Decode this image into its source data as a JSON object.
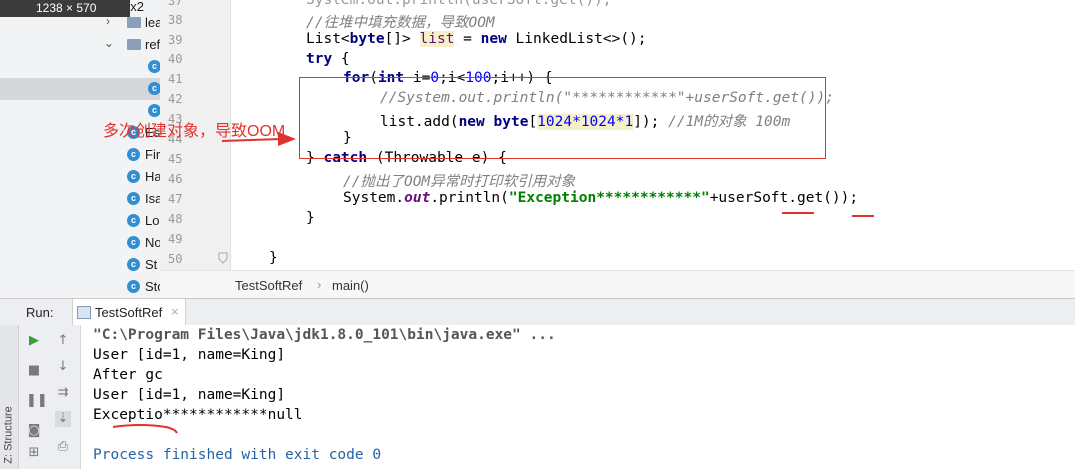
{
  "overlay": {
    "dimensions": "1238 × 570"
  },
  "tree": {
    "items": [
      {
        "label": "ex2",
        "kind": "folder"
      },
      {
        "label": "lea",
        "kind": "folder"
      },
      {
        "label": "ref",
        "kind": "folder"
      },
      {
        "label": "",
        "kind": "class"
      },
      {
        "label": "",
        "kind": "class"
      },
      {
        "label": "",
        "kind": "class"
      },
      {
        "label": "Es",
        "kind": "class"
      },
      {
        "label": "Fir",
        "kind": "class"
      },
      {
        "label": "Ha",
        "kind": "class"
      },
      {
        "label": "Isa",
        "kind": "class"
      },
      {
        "label": "Lo",
        "kind": "class"
      },
      {
        "label": "No",
        "kind": "class"
      },
      {
        "label": "St",
        "kind": "class"
      },
      {
        "label": "Sto",
        "kind": "class"
      }
    ]
  },
  "editor": {
    "line_numbers": [
      "37",
      "38",
      "39",
      "40",
      "41",
      "42",
      "43",
      "44",
      "45",
      "46",
      "47",
      "48",
      "49",
      "50"
    ],
    "line37": "System.out.println(userSoft.get());",
    "line38_comment": "//往堆中填充数据，导致OOM",
    "line39_a": "List<",
    "line39_kw": "byte",
    "line39_b": "[]> ",
    "line39_var": "list",
    "line39_c": " = ",
    "line39_new": "new",
    "line39_d": " LinkedList<>();",
    "line40_kw": "try",
    "line40_b": " {",
    "line41_kw": "for",
    "line41_a": "(",
    "line41_int": "int",
    "line41_b": " i=",
    "line41_n0": "0",
    "line41_c": ";i<",
    "line41_n100": "100",
    "line41_d": ";i++) {",
    "line42_comment": "//System.out.println(\"************\"+userSoft.get());",
    "line43_a": "list.add(",
    "line43_new": "new",
    "line43_sp": " ",
    "line43_byte": "byte",
    "line43_b": "[",
    "line43_expr": "1024*1024*1",
    "line43_c": "]); ",
    "line43_comment": "//1M的对象 100m",
    "line44": "}",
    "line45_a": "} ",
    "line45_kw": "catch",
    "line45_b": " (Throwable e) {",
    "line46_comment": "//抛出了OOM异常时打印软引用对象",
    "line47_a": "System.",
    "line47_out": "out",
    "line47_b": ".println(",
    "line47_str": "\"Exception************\"",
    "line47_c": "+userSoft.get());",
    "line48": "}",
    "line50": "}"
  },
  "breadcrumb": {
    "class_name": "TestSoftRef",
    "sep": "›",
    "method": "main()"
  },
  "run": {
    "label": "Run:",
    "tab": "TestSoftRef",
    "tab_close": "×",
    "console_lines": [
      "\"C:\\Program Files\\Java\\jdk1.8.0_101\\bin\\java.exe\" ...",
      "User [id=1, name=King]",
      "After gc",
      "User [id=1, name=King]",
      "Exceptio************null",
      "",
      "Process finished with exit code 0"
    ],
    "side_label": "Z: Structure"
  },
  "annotation": {
    "text": "多次创建对象，导致OOM",
    "color": "#e0332e"
  }
}
